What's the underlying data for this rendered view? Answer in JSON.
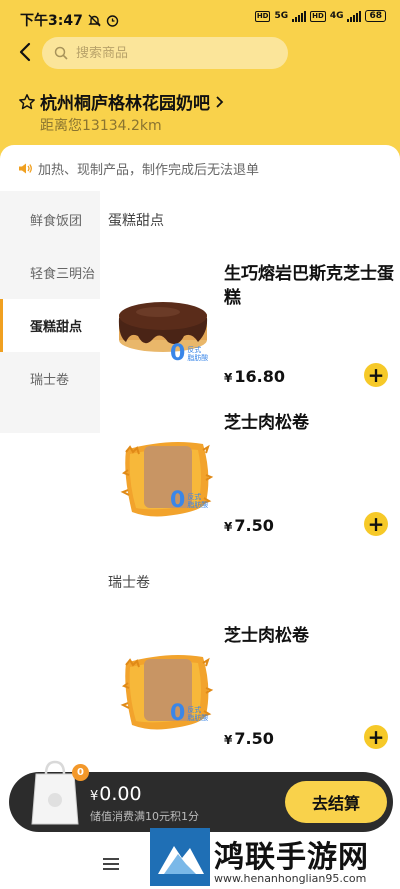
{
  "status_bar": {
    "time": "下午3:47",
    "network_1": "5G",
    "network_2": "4G",
    "battery": "68"
  },
  "header": {
    "search_placeholder": "搜索商品",
    "store_name": "杭州桐庐格林花园奶吧",
    "distance": "距离您13134.2km",
    "notice": "加热、现制产品，制作完成后无法退单",
    "colors": {
      "header_bg": "#f9d24b",
      "accent": "#f6c928"
    }
  },
  "sidebar": {
    "categories": [
      {
        "label": "鲜食饭团",
        "active": false
      },
      {
        "label": "轻食三明治",
        "active": false
      },
      {
        "label": "蛋糕甜点",
        "active": true
      },
      {
        "label": "瑞士卷",
        "active": false
      }
    ]
  },
  "sections": [
    {
      "title": "蛋糕甜点",
      "products": [
        {
          "name": "生巧熔岩巴斯克芝士蛋糕",
          "currency": "¥",
          "price": "16.80",
          "badge_zero": "0",
          "badge_text_1": "反式",
          "badge_text_2": "脂肪酸",
          "image_icon": "chocolate-cake-image"
        },
        {
          "name": "芝士肉松卷",
          "currency": "¥",
          "price": "7.50",
          "badge_zero": "0",
          "badge_text_1": "反式",
          "badge_text_2": "脂肪酸",
          "image_icon": "pork-floss-roll-image"
        }
      ]
    },
    {
      "title": "瑞士卷",
      "products": [
        {
          "name": "芝士肉松卷",
          "currency": "¥",
          "price": "7.50",
          "badge_zero": "0",
          "badge_text_1": "反式",
          "badge_text_2": "脂肪酸",
          "image_icon": "pork-floss-roll-image"
        }
      ]
    }
  ],
  "cart": {
    "count": "0",
    "currency": "¥",
    "total": "0.00",
    "note": "储值消费满10元积1分",
    "checkout_label": "去结算"
  },
  "watermark": {
    "title": "鸿联手游网",
    "url": "www.henanhonglian95.com"
  }
}
